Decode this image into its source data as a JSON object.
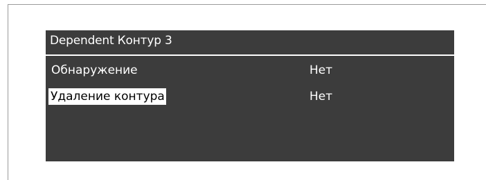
{
  "screen": {
    "title": "Dependent Контур 3",
    "menu": [
      {
        "label": "Обнаружение",
        "value": "Нет",
        "selected": false
      },
      {
        "label": "Удаление контура",
        "value": "Нет",
        "selected": true
      }
    ]
  },
  "colors": {
    "screen_background": "#3c3c3c",
    "text": "#ffffff",
    "selection_background": "#ffffff",
    "selection_text": "#000000"
  }
}
